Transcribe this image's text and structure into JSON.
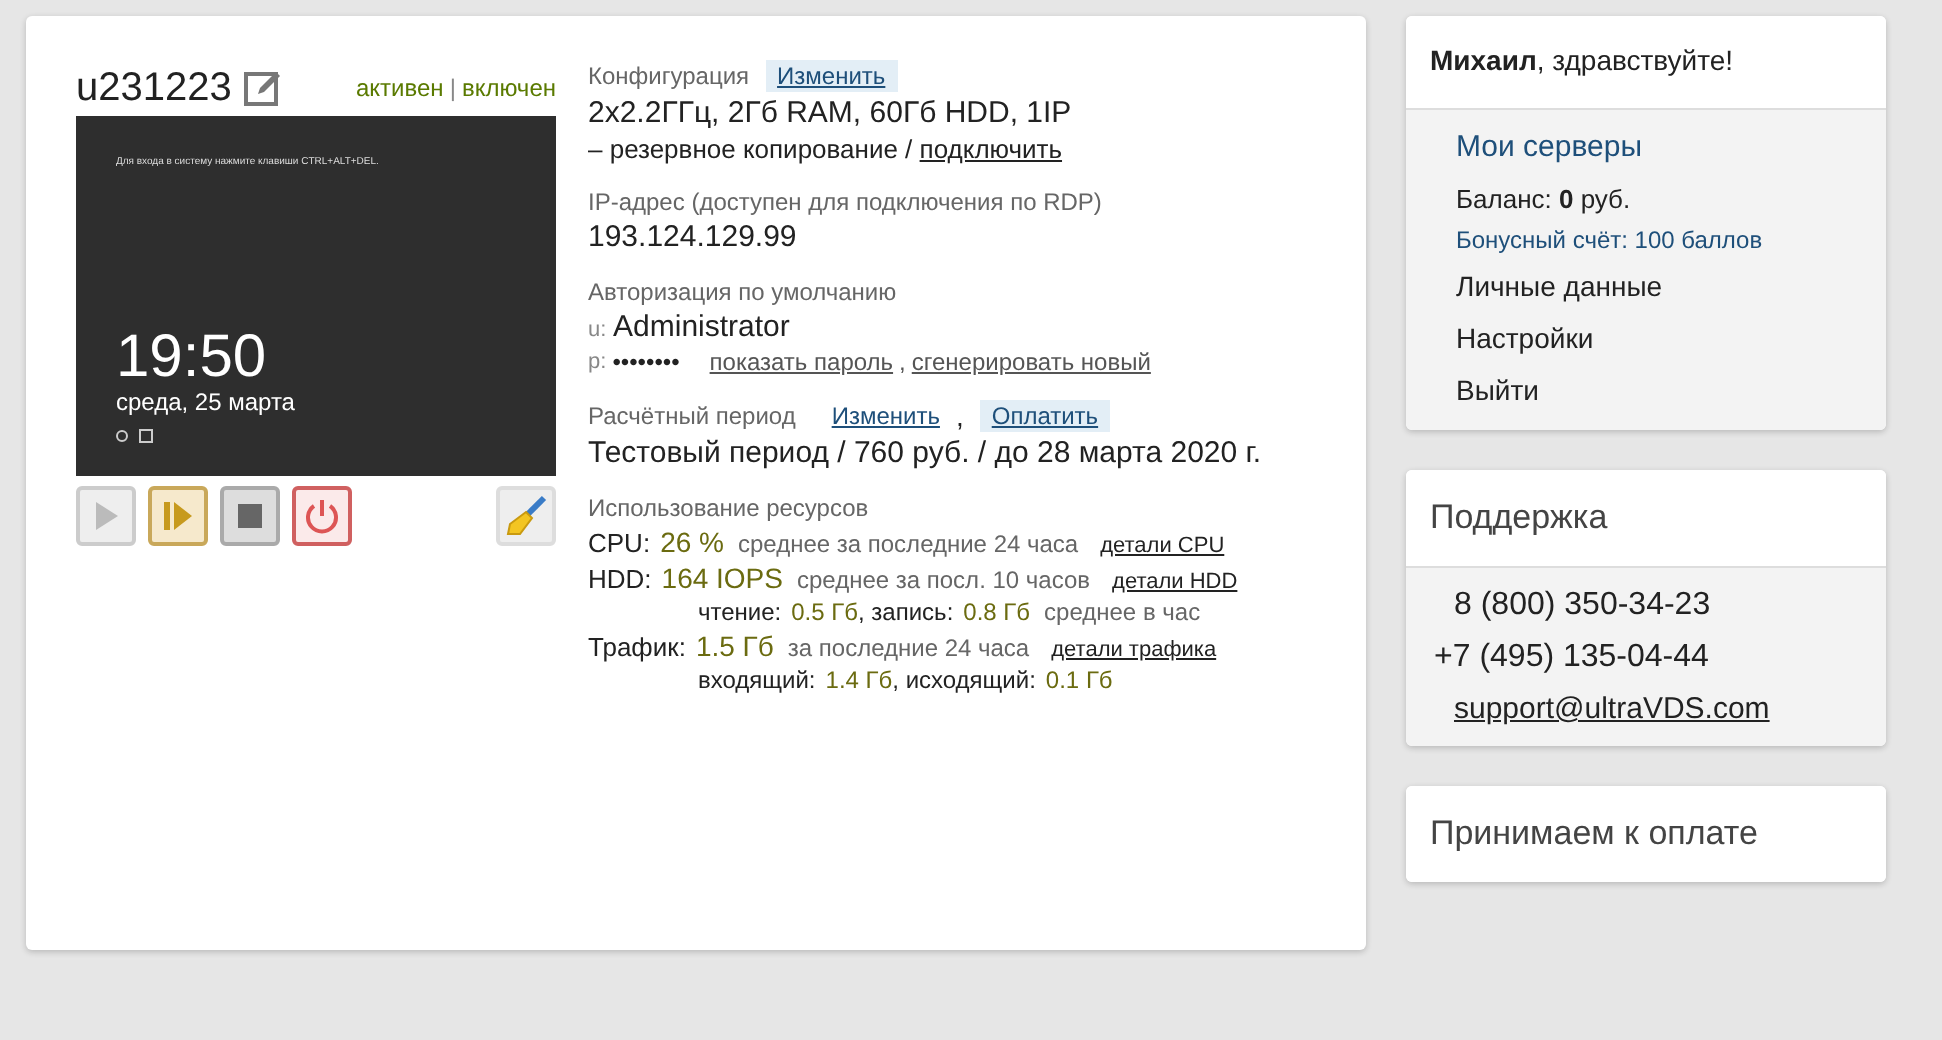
{
  "server": {
    "name": "u231223",
    "status": "активен",
    "separator": "|",
    "power": "включен",
    "screen": {
      "hint": "Для входа в систему нажмите клавиши CTRL+ALT+DEL.",
      "time": "19:50",
      "date": "среда, 25 марта"
    },
    "controls": [
      {
        "kind": "start",
        "disabled": true
      },
      {
        "kind": "resume",
        "disabled": false
      },
      {
        "kind": "stop",
        "disabled": false
      },
      {
        "kind": "power",
        "disabled": false
      }
    ]
  },
  "config": {
    "label": "Конфигурация",
    "action": "Изменить",
    "value": "2x2.2ГГц, 2Гб RAM, 60Гб HDD, 1IP",
    "backup": "– резервное копирование /",
    "backup_action": "подключить"
  },
  "ip": {
    "label": "IP-адрес (доступен для подключения по RDP)",
    "value": "193.124.129.99"
  },
  "auth": {
    "label": "Авторизация по умолчанию",
    "user_prefix": "u:",
    "user": "Administrator",
    "pass_prefix": "p:",
    "password": "••••••••",
    "show": "показать пароль",
    "sep": ",",
    "generate": "сгенерировать новый"
  },
  "billing": {
    "label": "Расчётный период",
    "change": "Изменить",
    "sep": ",",
    "pay": "Оплатить",
    "value": "Тестовый период / 760 руб. / до 28 марта 2020 г."
  },
  "resources": {
    "label": "Использование ресурсов",
    "items": [
      {
        "label": "CPU:",
        "value": "26 %",
        "note": "среднее за последние 24 часа",
        "link": "детали CPU"
      },
      {
        "label": "HDD:",
        "value": "164 IOPS",
        "note": "среднее за посл. 10 часов",
        "link": "детали HDD",
        "breakdown": [
          {
            "label": "чтение:",
            "value": "0.5 Гб"
          },
          {
            "label": ", запись:",
            "value": "0.8 Гб"
          }
        ],
        "breakdown_note": "среднее в час"
      },
      {
        "label": "Трафик:",
        "value": "1.5 Гб",
        "note": "за последние 24 часа",
        "link": "детали трафика",
        "breakdown": [
          {
            "label": "входящий:",
            "value": "1.4 Гб"
          },
          {
            "label": ", исходящий:",
            "value": "0.1 Гб"
          }
        ]
      }
    ]
  },
  "account": {
    "greeting": "**Михаил**, здравствуйте!",
    "items": [
      {
        "kind": "link",
        "text": "Мои серверы"
      },
      {
        "kind": "balance",
        "text": "Баланс:  **0** руб."
      },
      {
        "kind": "bonus",
        "text": "Бонусный счёт: 100 баллов"
      },
      {
        "kind": "menu",
        "text": "Личные данные"
      },
      {
        "kind": "menu",
        "text": "Настройки"
      },
      {
        "kind": "menu",
        "text": "Выйти"
      }
    ]
  },
  "support": {
    "title": "Поддержка",
    "phones": [
      "8 (800) 350-34-23",
      "+7 (495) 135-04-44"
    ],
    "email": "support@ultraVDS.com"
  },
  "payment": {
    "title": "Принимаем к оплате"
  }
}
